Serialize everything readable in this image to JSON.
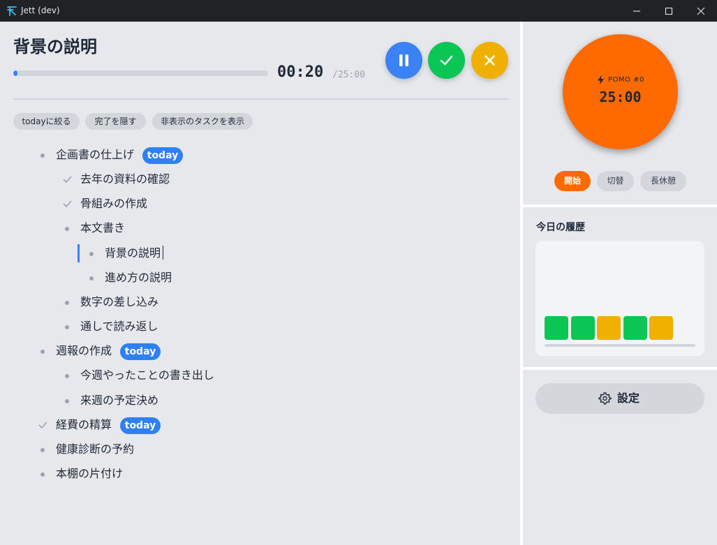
{
  "window": {
    "title": "Jett (dev)",
    "icons": {
      "logo": "jett-logo-icon",
      "minimize": "minimize-icon",
      "maximize": "maximize-icon",
      "close": "close-icon"
    }
  },
  "current_task": {
    "title": "背景の説明",
    "elapsed": "00:20",
    "total": "/25:00",
    "progress_fraction": 0.013
  },
  "timer_controls": {
    "pause": {
      "icon": "pause-icon",
      "color": "#3b82f6"
    },
    "complete": {
      "icon": "check-icon",
      "color": "#0bc555"
    },
    "cancel": {
      "icon": "x-icon",
      "color": "#f0b000"
    }
  },
  "filters": {
    "today": "todayに絞る",
    "hide_done": "完了を隠す",
    "show_hidden": "非表示のタスクを表示"
  },
  "tasks": [
    {
      "text": "企画書の仕上げ",
      "badge": "today",
      "done": false,
      "level": 0
    },
    {
      "text": "去年の資料の確認",
      "done": true,
      "level": 1
    },
    {
      "text": "骨組みの作成",
      "done": true,
      "level": 1
    },
    {
      "text": "本文書き",
      "done": false,
      "level": 1
    },
    {
      "text": "背景の説明",
      "done": false,
      "level": 2,
      "active": true
    },
    {
      "text": "進め方の説明",
      "done": false,
      "level": 2
    },
    {
      "text": "数字の差し込み",
      "done": false,
      "level": 1
    },
    {
      "text": "通しで読み返し",
      "done": false,
      "level": 1
    },
    {
      "text": "週報の作成",
      "badge": "today",
      "done": false,
      "level": 0
    },
    {
      "text": "今週やったことの書き出し",
      "done": false,
      "level": 1
    },
    {
      "text": "来週の予定決め",
      "done": false,
      "level": 1
    },
    {
      "text": "経費の精算",
      "badge": "today",
      "done": true,
      "level": 0
    },
    {
      "text": "健康診断の予約",
      "done": false,
      "level": 0
    },
    {
      "text": "本棚の片付け",
      "done": false,
      "level": 0
    }
  ],
  "pomodoro": {
    "label": "POMO #0",
    "time": "25:00",
    "icon": "bolt-icon",
    "color": "#ff6a00",
    "modes": {
      "start": "開始",
      "switch": "切替",
      "long_break": "長休憩"
    },
    "active_mode": "start"
  },
  "history": {
    "title": "今日の履歴",
    "blocks": [
      {
        "type": "work",
        "color": "#0bc555"
      },
      {
        "type": "work",
        "color": "#0bc555"
      },
      {
        "type": "break",
        "color": "#f0b000"
      },
      {
        "type": "work",
        "color": "#0bc555"
      },
      {
        "type": "break",
        "color": "#f0b000"
      }
    ]
  },
  "settings": {
    "label": "設定",
    "icon": "gear-icon"
  }
}
